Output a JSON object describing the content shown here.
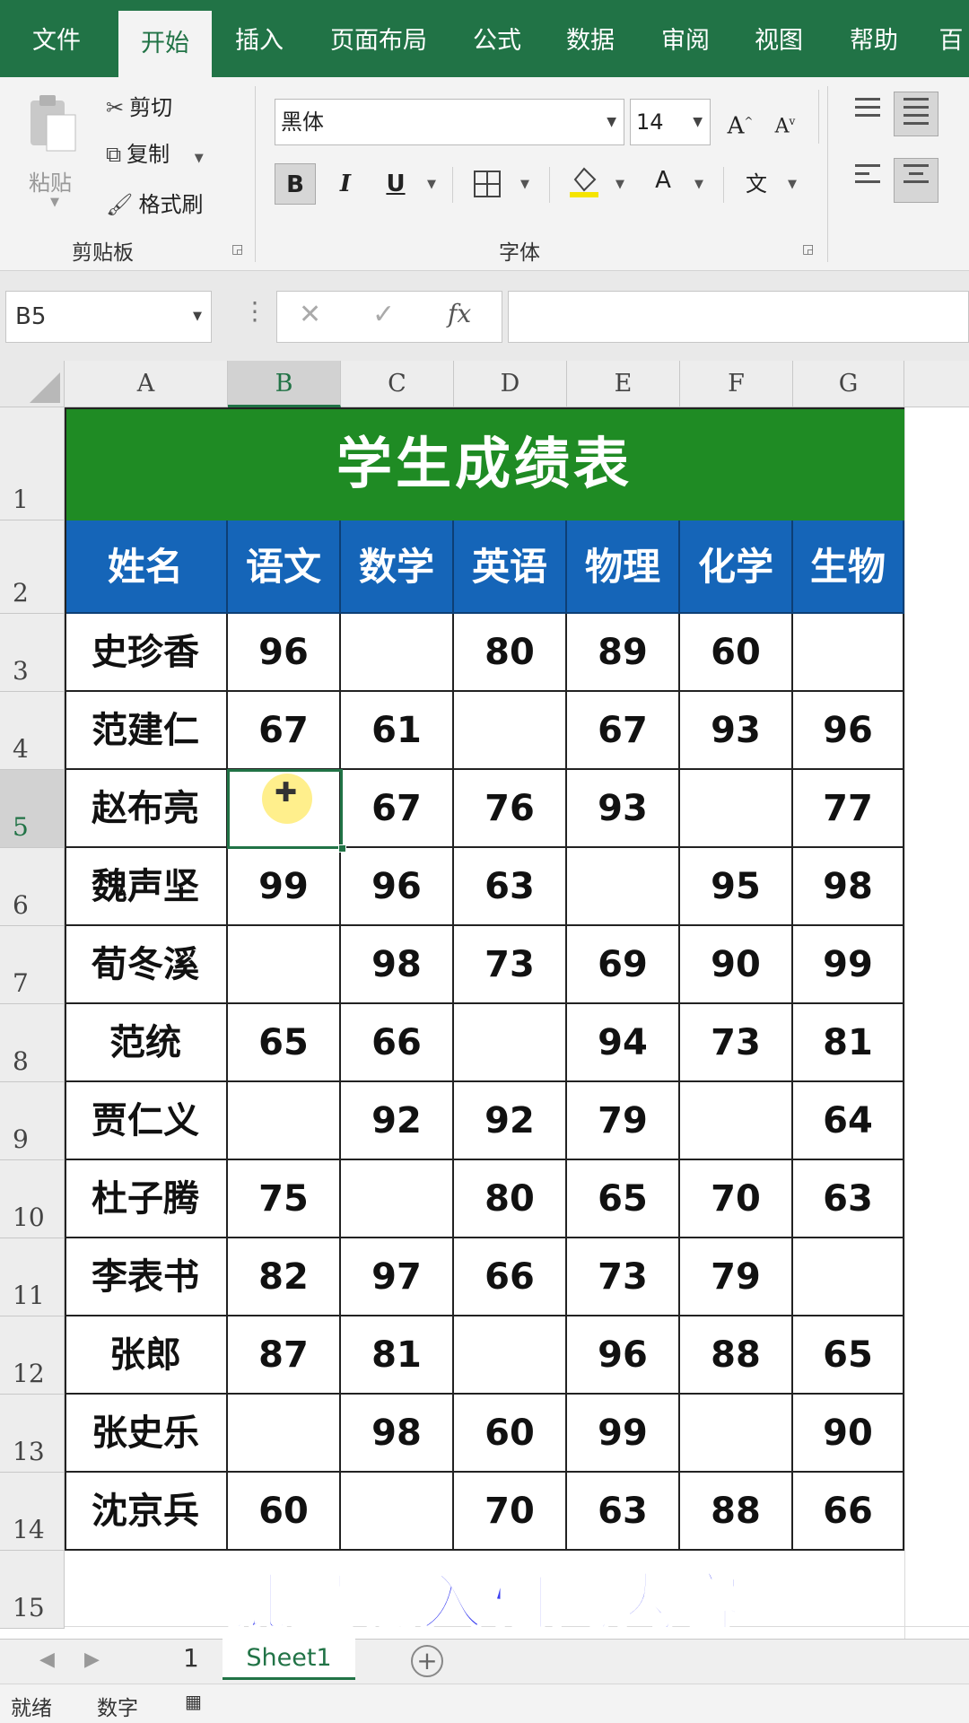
{
  "ribbon_tabs": [
    "文件",
    "开始",
    "插入",
    "页面布局",
    "公式",
    "数据",
    "审阅",
    "视图",
    "帮助",
    "百"
  ],
  "clipboard": {
    "paste_label": "粘贴",
    "cut_label": "剪切",
    "copy_label": "复制",
    "format_painter_label": "格式刷",
    "group_label": "剪贴板"
  },
  "font": {
    "name": "黑体",
    "size": "14",
    "group_label": "字体",
    "bold": "B",
    "italic": "I",
    "underline": "U",
    "grow": "A",
    "shrink": "A",
    "font_color": "A",
    "phonetic": "文"
  },
  "formula_bar": {
    "name_box": "B5",
    "cancel": "✕",
    "enter": "✓",
    "fx": "fx",
    "value": ""
  },
  "columns": [
    "A",
    "B",
    "C",
    "D",
    "E",
    "F",
    "G"
  ],
  "rows": [
    "1",
    "2",
    "3",
    "4",
    "5",
    "6",
    "7",
    "8",
    "9",
    "10",
    "11",
    "12",
    "13",
    "14",
    "15"
  ],
  "selected_cell": "B5",
  "table": {
    "title": "学生成绩表",
    "headers": [
      "姓名",
      "语文",
      "数学",
      "英语",
      "物理",
      "化学",
      "生物"
    ],
    "rows": [
      [
        "史珍香",
        "96",
        "",
        "80",
        "89",
        "60",
        ""
      ],
      [
        "范建仁",
        "67",
        "61",
        "",
        "67",
        "93",
        "96"
      ],
      [
        "赵布亮",
        "",
        "67",
        "76",
        "93",
        "",
        "77"
      ],
      [
        "魏声坚",
        "99",
        "96",
        "63",
        "",
        "95",
        "98"
      ],
      [
        "荀冬溪",
        "",
        "98",
        "73",
        "69",
        "90",
        "99"
      ],
      [
        "范统",
        "65",
        "66",
        "",
        "94",
        "73",
        "81"
      ],
      [
        "贾仁义",
        "",
        "92",
        "92",
        "79",
        "",
        "64"
      ],
      [
        "杜子腾",
        "75",
        "",
        "80",
        "65",
        "70",
        "63"
      ],
      [
        "李表书",
        "82",
        "97",
        "66",
        "73",
        "79",
        ""
      ],
      [
        "张郎",
        "87",
        "81",
        "",
        "96",
        "88",
        "65"
      ],
      [
        "张史乐",
        "",
        "98",
        "60",
        "99",
        "",
        "90"
      ],
      [
        "沈京兵",
        "60",
        "",
        "70",
        "63",
        "88",
        "66"
      ]
    ]
  },
  "caption": "批量输入相同内容",
  "sheet_tabs": {
    "number": "1",
    "active": "Sheet1",
    "add": "+"
  },
  "status": {
    "ready": "就绪",
    "num": "数字"
  },
  "colors": {
    "excel_green": "#217346",
    "title_fill": "#1f8b24",
    "header_fill": "#1565b8",
    "caption": "#3b3ff0"
  }
}
